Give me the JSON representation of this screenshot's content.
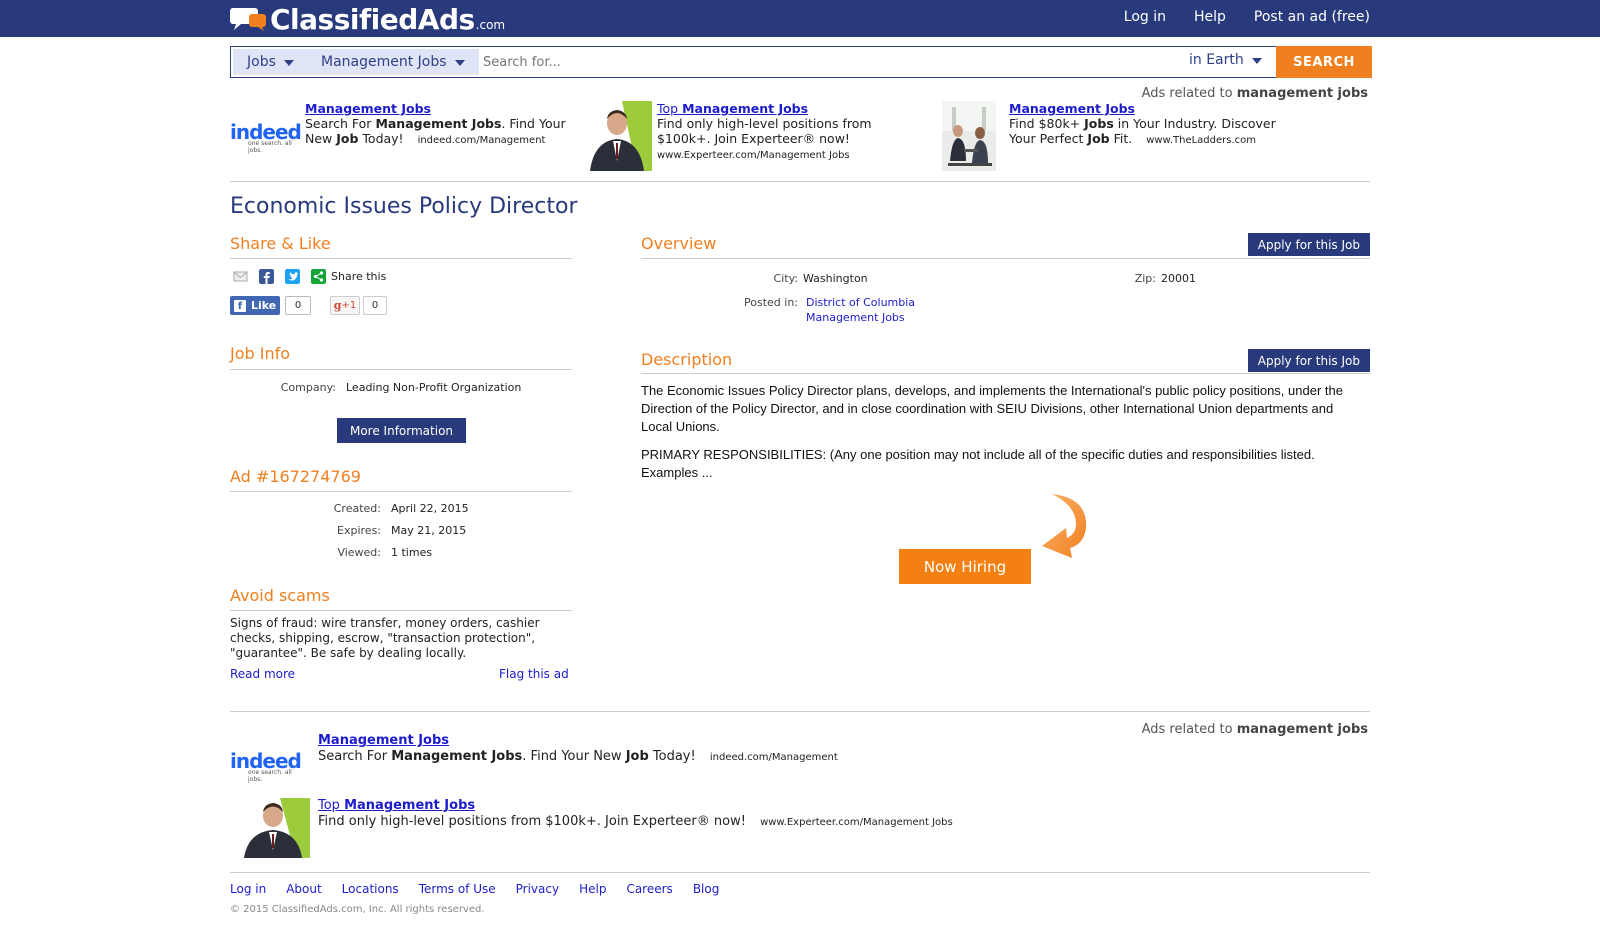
{
  "header": {
    "logo_main": "ClassifiedAds",
    "logo_com": ".com",
    "links": [
      "Log in",
      "Help",
      "Post an ad (free)"
    ]
  },
  "search": {
    "category": "Jobs",
    "subcategory": "Management Jobs",
    "placeholder": "Search for...",
    "location": "in Earth",
    "button": "SEARCH"
  },
  "ads_related": {
    "prefix": "Ads related to",
    "keyword": "management jobs"
  },
  "top_ads": [
    {
      "title_pre": "",
      "title": "Management Jobs",
      "line1_a": "Search For ",
      "line1_b": "Management Jobs",
      "line1_c": ". Find Your",
      "line2_a": "New ",
      "line2_b": "Job",
      "line2_c": " Today!",
      "url": "indeed.com/Management"
    },
    {
      "title_pre": "Top ",
      "title": "Management Jobs",
      "line1_a": "Find only high-level positions from",
      "line2_a": "$100k+. Join Experteer® now!",
      "url": "www.Experteer.com/Management Jobs"
    },
    {
      "title_pre": "",
      "title": "Management Jobs",
      "line1_a": "Find $80k+ ",
      "line1_b": "Jobs",
      "line1_c": " in Your Industry. Discover",
      "line2_a": "Your Perfect ",
      "line2_b": "Job",
      "line2_c": " Fit.",
      "url": "www.TheLadders.com"
    }
  ],
  "indeed_logo": {
    "word": "indeed",
    "tagline": "one search. all jobs."
  },
  "page_title": "Economic Issues Policy Director",
  "share": {
    "heading": "Share & Like",
    "share_this": "Share this",
    "like_label": "Like",
    "like_count": "0",
    "gplus_label": "+1",
    "gplus_count": "0"
  },
  "job_info": {
    "heading": "Job Info",
    "company_label": "Company:",
    "company_value": "Leading Non-Profit Organization",
    "more_button": "More Information"
  },
  "ad_info": {
    "heading": "Ad #167274769",
    "created_label": "Created:",
    "created_value": "April 22, 2015",
    "expires_label": "Expires:",
    "expires_value": "May 21, 2015",
    "viewed_label": "Viewed:",
    "viewed_value": "1 times"
  },
  "scams": {
    "heading": "Avoid scams",
    "text": "Signs of fraud: wire transfer, money orders, cashier checks, shipping, escrow, \"transaction protection\", \"guarantee\". Be safe by dealing locally.",
    "read_more": "Read more",
    "flag": "Flag this ad"
  },
  "overview": {
    "heading": "Overview",
    "apply": "Apply for this Job",
    "city_label": "City:",
    "city_value": "Washington",
    "zip_label": "Zip:",
    "zip_value": "20001",
    "posted_label": "Posted in:",
    "posted_links": [
      "District of Columbia",
      "Management Jobs"
    ]
  },
  "description": {
    "heading": "Description",
    "apply": "Apply for this Job",
    "para1": "The Economic Issues Policy Director plans, develops, and implements the International's public policy positions, under the Direction of the Policy Director, and in close coordination with SEIU Divisions, other International Union departments and Local Unions.",
    "para2": "PRIMARY RESPONSIBILITIES: (Any one position may not include all of the specific duties and responsibilities listed. Examples ...",
    "now_hiring": "Now Hiring"
  },
  "bottom_ads": [
    {
      "title_pre": "",
      "title": "Management Jobs",
      "text_a": "Search For ",
      "text_b": "Management Jobs",
      "text_c": ". Find Your New ",
      "text_d": "Job",
      "text_e": " Today!",
      "url": "indeed.com/Management"
    },
    {
      "title_pre": "Top ",
      "title": "Management Jobs",
      "text_a": "Find only high-level positions from $100k+. Join Experteer® now!",
      "url": "www.Experteer.com/Management Jobs"
    }
  ],
  "footer": {
    "links": [
      "Log in",
      "About",
      "Locations",
      "Terms of Use",
      "Privacy",
      "Help",
      "Careers",
      "Blog"
    ],
    "copyright": "© 2015 ClassifiedAds.com, Inc. All rights reserved."
  },
  "colors": {
    "navy": "#283a7c",
    "orange": "#f07f20",
    "link": "#1c1ccc"
  }
}
